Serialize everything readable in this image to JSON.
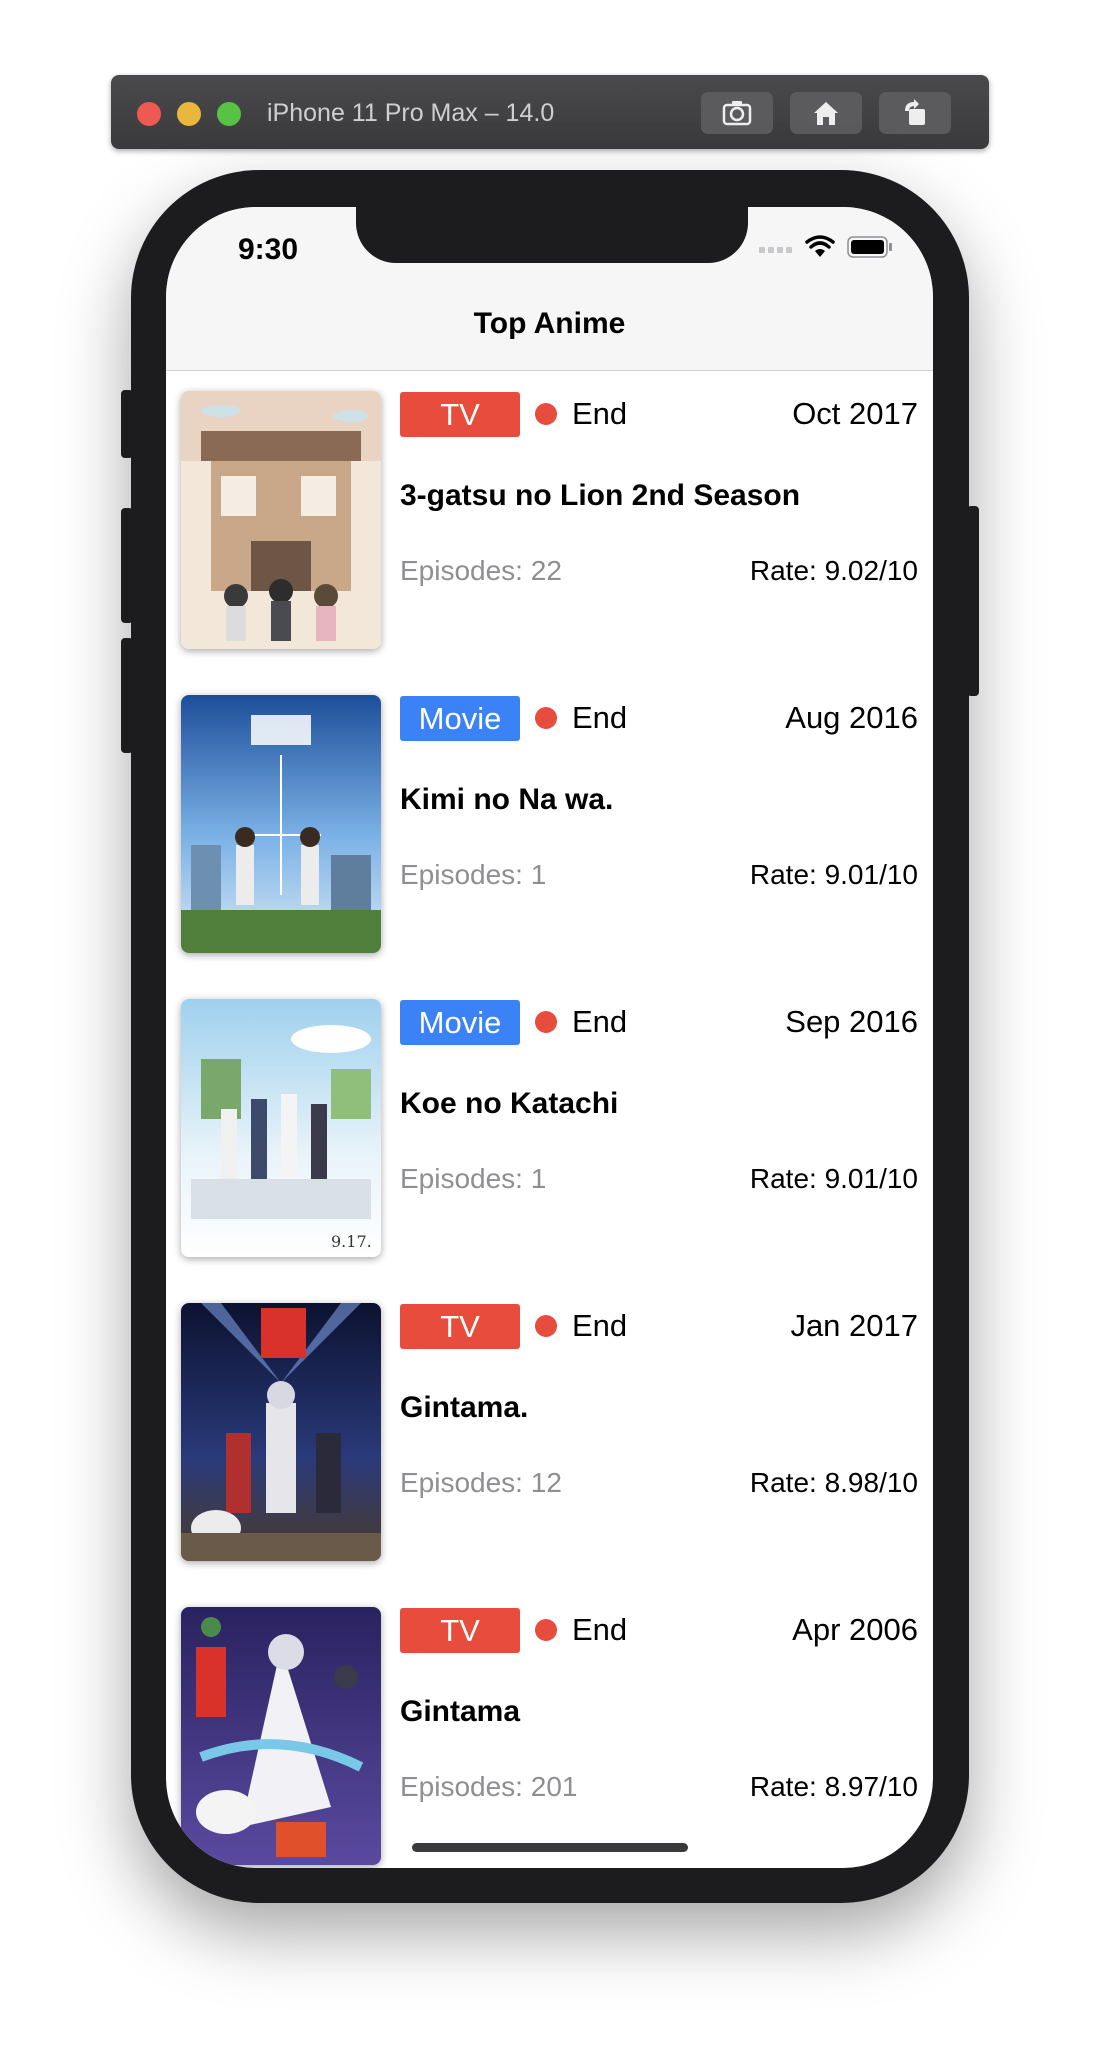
{
  "simulator": {
    "title": "iPhone 11 Pro Max – 14.0"
  },
  "status_bar": {
    "time": "9:30"
  },
  "nav": {
    "title": "Top Anime"
  },
  "anime": [
    {
      "type": "TV",
      "status": "End",
      "date": "Oct 2017",
      "title": "3-gatsu no Lion 2nd Season",
      "episodes": "Episodes: 22",
      "rate": "Rate: 9.02/10"
    },
    {
      "type": "Movie",
      "status": "End",
      "date": "Aug 2016",
      "title": "Kimi no Na wa.",
      "episodes": "Episodes: 1",
      "rate": "Rate: 9.01/10"
    },
    {
      "type": "Movie",
      "status": "End",
      "date": "Sep 2016",
      "title": "Koe no Katachi",
      "episodes": "Episodes: 1",
      "rate": "Rate: 9.01/10"
    },
    {
      "type": "TV",
      "status": "End",
      "date": "Jan 2017",
      "title": "Gintama.",
      "episodes": "Episodes: 12",
      "rate": "Rate: 8.98/10"
    },
    {
      "type": "TV",
      "status": "End",
      "date": "Apr 2006",
      "title": "Gintama",
      "episodes": "Episodes: 201",
      "rate": "Rate: 8.97/10"
    }
  ],
  "colors": {
    "tv": "#e74c3c",
    "movie": "#3b82f6",
    "status_end": "#e74c3c"
  }
}
